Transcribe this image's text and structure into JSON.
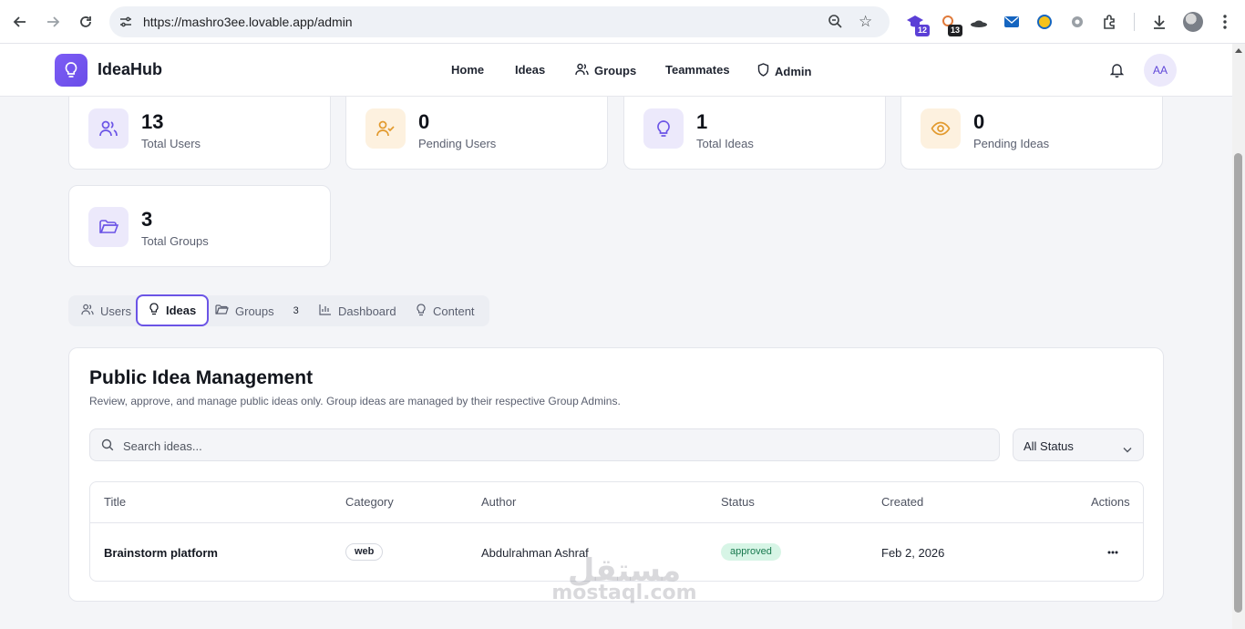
{
  "browser": {
    "url": "https://mashro3ee.lovable.app/admin",
    "extension_badges": [
      "12",
      "13"
    ]
  },
  "header": {
    "brand": "IdeaHub",
    "nav": [
      "Home",
      "Ideas",
      "Groups",
      "Teammates",
      "Admin"
    ],
    "avatar_initials": "AA"
  },
  "stats": [
    {
      "value": "13",
      "label": "Total Users",
      "color": "#ece9fb",
      "icon": "users-icon"
    },
    {
      "value": "0",
      "label": "Pending Users",
      "color": "#fdf1df",
      "icon": "user-check-icon"
    },
    {
      "value": "1",
      "label": "Total Ideas",
      "color": "#ece9fb",
      "icon": "lightbulb-icon"
    },
    {
      "value": "0",
      "label": "Pending Ideas",
      "color": "#fdf1df",
      "icon": "eye-icon"
    },
    {
      "value": "3",
      "label": "Total Groups",
      "color": "#ece9fb",
      "icon": "folder-icon"
    }
  ],
  "tabs": [
    {
      "label": "Users"
    },
    {
      "label": "Ideas",
      "active": true
    },
    {
      "label": "Groups",
      "count": "3"
    },
    {
      "label": "Dashboard"
    },
    {
      "label": "Content"
    }
  ],
  "panel": {
    "title": "Public Idea Management",
    "subtitle": "Review, approve, and manage public ideas only. Group ideas are managed by their respective Group Admins.",
    "search_placeholder": "Search ideas...",
    "status_filter": "All Status"
  },
  "table": {
    "columns": [
      "Title",
      "Category",
      "Author",
      "Status",
      "Created",
      "Actions"
    ],
    "rows": [
      {
        "title": "Brainstorm platform",
        "category": "web",
        "author": "Abdulrahman Ashraf",
        "status": "approved",
        "created": "Feb 2, 2026"
      }
    ]
  },
  "watermark": {
    "arabic": "مستقل",
    "latin": "mostaql.com"
  },
  "colors": {
    "accent": "#6b54e6",
    "approved_bg": "#d7f5e6",
    "approved_text": "#18794e"
  }
}
